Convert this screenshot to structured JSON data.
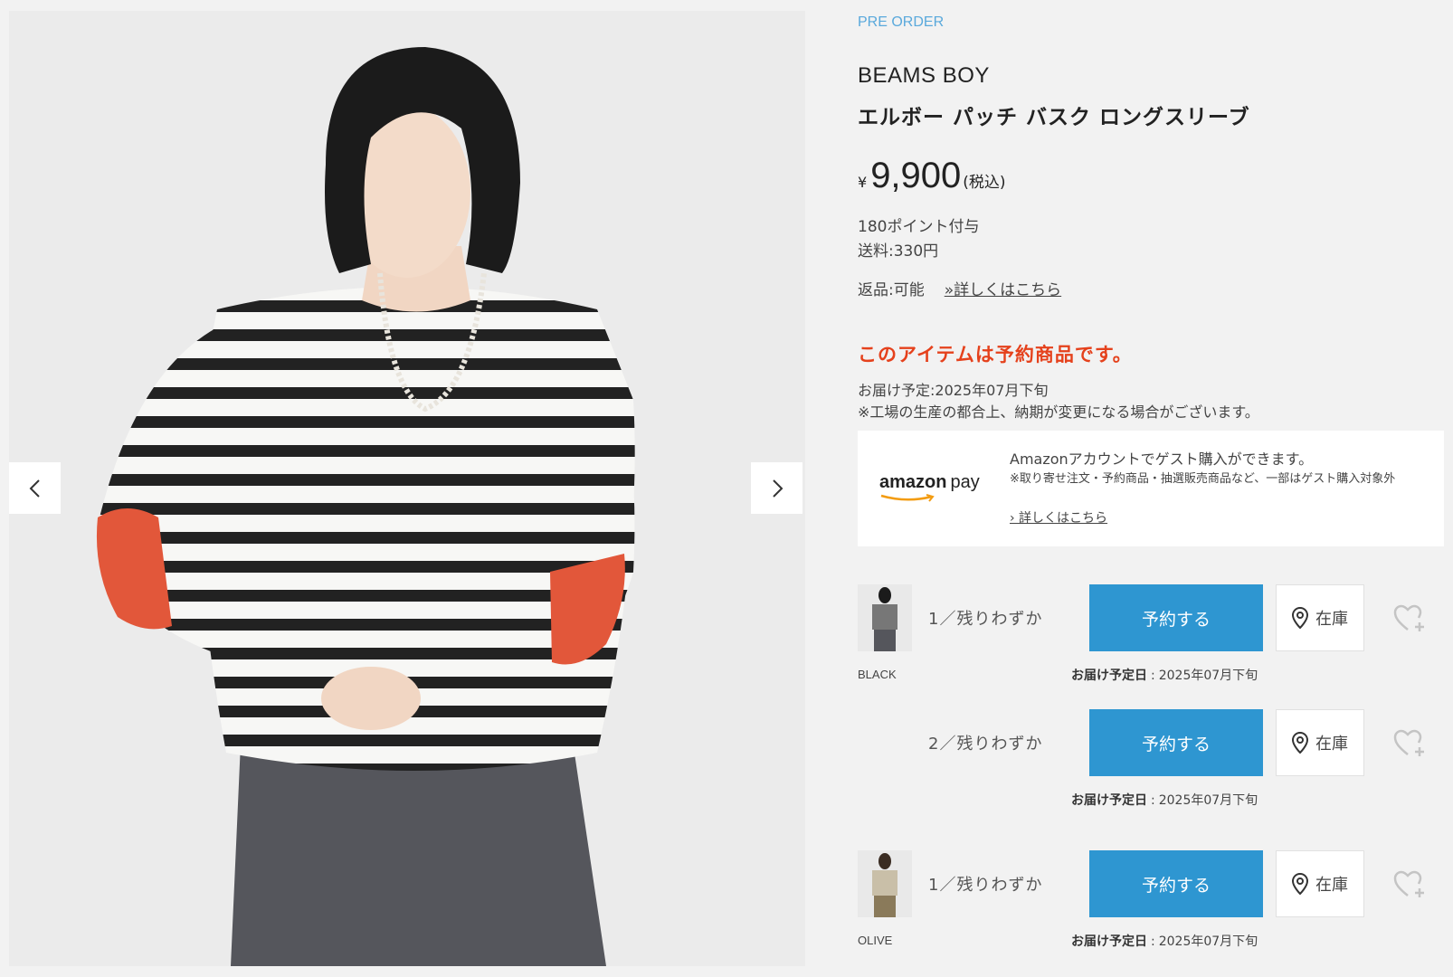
{
  "gallery": {
    "prev_icon": "chevron-left-icon",
    "next_icon": "chevron-right-icon"
  },
  "product": {
    "badge": "PRE ORDER",
    "brand": "BEAMS BOY",
    "name": "エルボー パッチ バスク ロングスリーブ",
    "price_currency": "¥",
    "price_value": "9,900",
    "price_tax": "(税込)",
    "points": "180ポイント付与",
    "shipping": "送料:330円",
    "returns_label": "返品:可能",
    "returns_link": "»詳しくはこちら"
  },
  "reservation": {
    "notice": "このアイテムは予約商品です。",
    "schedule": "お届け予定:2025年07月下旬",
    "note": "※工場の生産の都合上、納期が変更になる場合がございます。"
  },
  "amazon_pay": {
    "logo_main": "amazon",
    "logo_pay": "pay",
    "title": "Amazonアカウントでゲスト購入ができます。",
    "note": "※取り寄せ注文・予約商品・抽選販売商品など、一部はゲスト購入対象外",
    "link": "› 詳しくはこちら"
  },
  "variants": [
    {
      "color": "BLACK",
      "stock": "1／残りわずか",
      "button": "予約する",
      "store": "在庫",
      "delivery_label": "お届け予定日",
      "delivery_sep": ":",
      "delivery_value": "2025年07月下旬"
    },
    {
      "color": "",
      "stock": "2／残りわずか",
      "button": "予約する",
      "store": "在庫",
      "delivery_label": "お届け予定日",
      "delivery_sep": ":",
      "delivery_value": "2025年07月下旬"
    },
    {
      "color": "OLIVE",
      "stock": "1／残りわずか",
      "button": "予約する",
      "store": "在庫",
      "delivery_label": "お届け予定日",
      "delivery_sep": ":",
      "delivery_value": "2025年07月下旬"
    }
  ],
  "colors": {
    "accent_blue": "#2e96d1",
    "notice_red": "#e5411c",
    "badge_blue": "#5aa9dc"
  }
}
